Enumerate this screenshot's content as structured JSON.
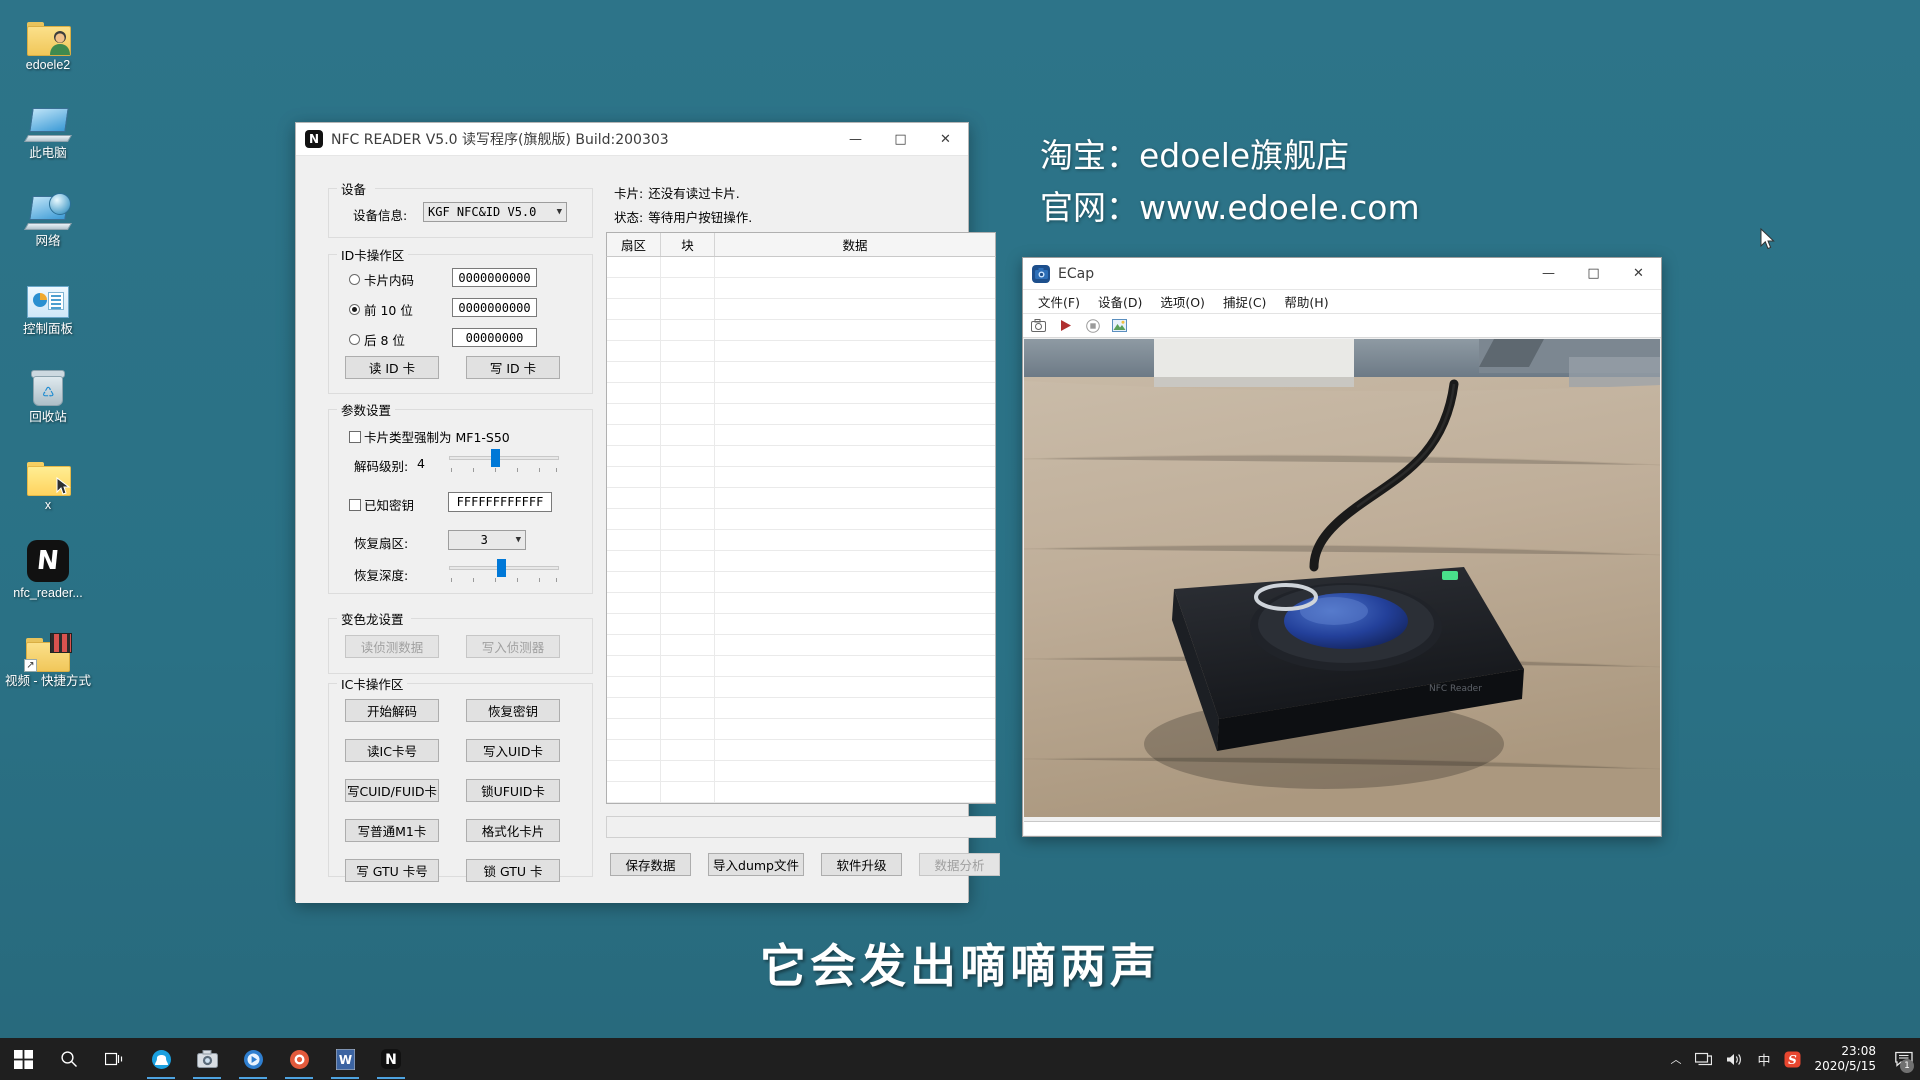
{
  "desktop": {
    "icons": [
      {
        "label": "edoele2",
        "icon": "folder-user-icon"
      },
      {
        "label": "此电脑",
        "icon": "this-pc-icon"
      },
      {
        "label": "网络",
        "icon": "network-icon"
      },
      {
        "label": "控制面板",
        "icon": "control-panel-icon"
      },
      {
        "label": "回收站",
        "icon": "recycle-bin-icon"
      },
      {
        "label": "x",
        "icon": "folder-icon"
      },
      {
        "label": "nfc_reader...",
        "icon": "nfc-app-icon"
      },
      {
        "label": "视频 - 快捷方式",
        "icon": "video-folder-shortcut-icon"
      }
    ]
  },
  "watermark": {
    "line1": "淘宝：edoele旗舰店",
    "line2": "官网：www.edoele.com"
  },
  "subtitle": "它会发出嘀嘀两声",
  "nfc_app": {
    "title": "NFC READER V5.0 读写程序(旗舰版) Build:200303",
    "window_buttons": {
      "minimize": "—",
      "maximize": "□",
      "close": "✕"
    },
    "device_group": {
      "caption": "设备",
      "label": "设备信息:",
      "selected": "KGF NFC&ID V5.0"
    },
    "id_group": {
      "caption": "ID卡操作区",
      "options": [
        {
          "label": "卡片内码",
          "value": "0000000000",
          "checked": false
        },
        {
          "label": "前 10 位",
          "value": "0000000000",
          "checked": true
        },
        {
          "label": "后  8 位",
          "value": "00000000",
          "checked": false
        }
      ],
      "read_button": "读 ID 卡",
      "write_button": "写 ID 卡"
    },
    "param_group": {
      "caption": "参数设置",
      "force_type_label": "卡片类型强制为 MF1-S50",
      "force_type_checked": false,
      "decode_level_label": "解码级别:",
      "decode_level_value": "4",
      "known_key_label": "已知密钥",
      "known_key_checked": false,
      "known_key_value": "FFFFFFFFFFFF",
      "recover_sector_label": "恢复扇区:",
      "recover_sector_value": "3",
      "recover_depth_label": "恢复深度:"
    },
    "chameleon_group": {
      "caption": "变色龙设置",
      "read_button": "读侦测数据",
      "write_button": "写入侦测器"
    },
    "ic_group": {
      "caption": "IC卡操作区",
      "buttons": [
        "开始解码",
        "恢复密钥",
        "读IC卡号",
        "写入UID卡",
        "写CUID/FUID卡",
        "锁UFUID卡",
        "写普通M1卡",
        "格式化卡片",
        "写 GTU 卡号",
        "锁 GTU 卡"
      ]
    },
    "status": {
      "card_label": "卡片:",
      "card_value": "还没有读过卡片.",
      "state_label": "状态:",
      "state_value": "等待用户按钮操作."
    },
    "grid": {
      "columns": [
        "扇区",
        "块",
        "数据"
      ],
      "rows": []
    },
    "bottom_buttons": [
      {
        "label": "保存数据",
        "disabled": false
      },
      {
        "label": "导入dump文件",
        "disabled": false
      },
      {
        "label": "软件升级",
        "disabled": false
      },
      {
        "label": "数据分析",
        "disabled": true
      }
    ]
  },
  "ecap_app": {
    "title": "ECap",
    "window_buttons": {
      "minimize": "—",
      "maximize": "□",
      "close": "✕"
    },
    "menus": [
      "文件(F)",
      "设备(D)",
      "选项(O)",
      "捕捉(C)",
      "帮助(H)"
    ],
    "toolbar_icons": [
      "camera-icon",
      "play-icon",
      "stop-icon",
      "image-icon"
    ]
  },
  "taskbar": {
    "start": "start-icon",
    "items": [
      {
        "name": "search-icon",
        "running": false
      },
      {
        "name": "task-view-icon",
        "running": false
      },
      {
        "name": "tim-icon",
        "running": true
      },
      {
        "name": "ecap-camera-icon",
        "running": true
      },
      {
        "name": "media-player-icon",
        "running": true
      },
      {
        "name": "browser-icon",
        "running": true
      },
      {
        "name": "word-icon",
        "running": true
      },
      {
        "name": "nfc-reader-icon",
        "running": true
      }
    ],
    "tray": {
      "chevron": "︿",
      "network": "network-tray-icon",
      "volume": "volume-tray-icon",
      "ime": "中",
      "sogou": "sogou-icon",
      "time": "23:08",
      "date": "2020/5/15",
      "notification_count": "1"
    }
  },
  "colors": {
    "desktop": "#2a7186",
    "accent": "#0078d7",
    "window_bg": "#f0f0f0",
    "taskbar": "#1f1f1f"
  }
}
